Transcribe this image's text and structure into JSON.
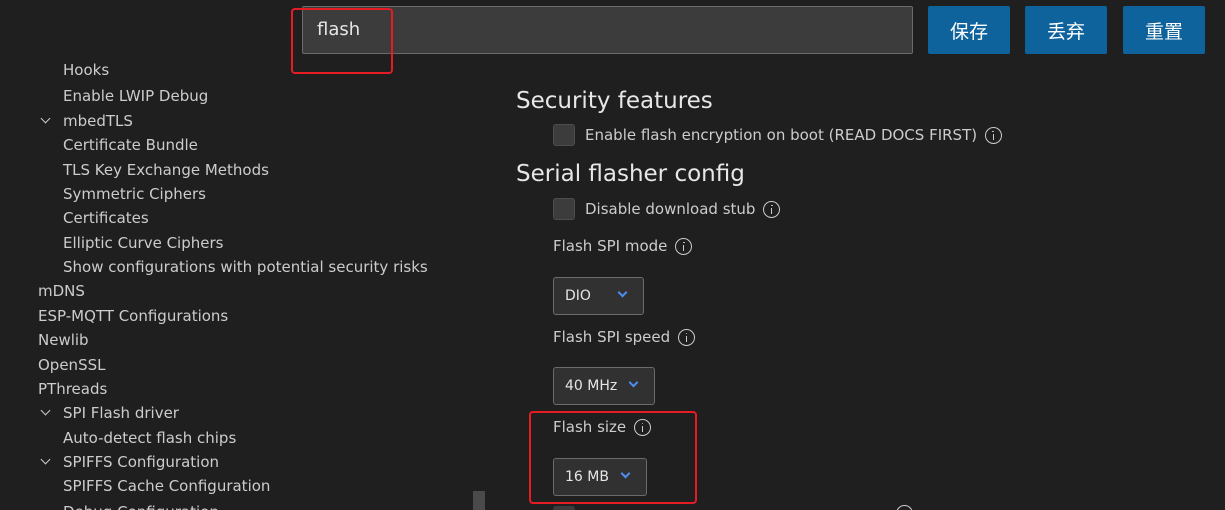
{
  "search": {
    "value": "flash"
  },
  "toolbar": {
    "save_label": "保存",
    "discard_label": "丢弃",
    "reset_label": "重置"
  },
  "sidebar": {
    "items": [
      {
        "label": "Hooks",
        "level": 2,
        "expanded": null
      },
      {
        "label": "Enable LWIP Debug",
        "level": 2,
        "expanded": null
      },
      {
        "label": "mbedTLS",
        "level": 1,
        "expanded": true
      },
      {
        "label": "Certificate Bundle",
        "level": 2,
        "expanded": null
      },
      {
        "label": "TLS Key Exchange Methods",
        "level": 2,
        "expanded": null
      },
      {
        "label": "Symmetric Ciphers",
        "level": 2,
        "expanded": null
      },
      {
        "label": "Certificates",
        "level": 2,
        "expanded": null
      },
      {
        "label": "Elliptic Curve Ciphers",
        "level": 2,
        "expanded": null
      },
      {
        "label": "Show configurations with potential security risks",
        "level": 2,
        "expanded": null
      },
      {
        "label": "mDNS",
        "level": 0,
        "expanded": null
      },
      {
        "label": "ESP-MQTT Configurations",
        "level": 0,
        "expanded": null
      },
      {
        "label": "Newlib",
        "level": 0,
        "expanded": null
      },
      {
        "label": "OpenSSL",
        "level": 0,
        "expanded": null
      },
      {
        "label": "PThreads",
        "level": 0,
        "expanded": null
      },
      {
        "label": "SPI Flash driver",
        "level": 1,
        "expanded": true
      },
      {
        "label": "Auto-detect flash chips",
        "level": 2,
        "expanded": null
      },
      {
        "label": "SPIFFS Configuration",
        "level": 1,
        "expanded": true
      },
      {
        "label": "SPIFFS Cache Configuration",
        "level": 2,
        "expanded": null
      },
      {
        "label": "Debug Configuration",
        "level": 2,
        "expanded": null
      }
    ]
  },
  "main": {
    "security_title": "Security features",
    "flash_encryption_label": "Enable flash encryption on boot (READ DOCS FIRST)",
    "flash_encryption_checked": false,
    "serial_title": "Serial flasher config",
    "disable_stub_label": "Disable download stub",
    "disable_stub_checked": false,
    "spi_mode_label": "Flash SPI mode",
    "spi_mode_value": "DIO",
    "spi_speed_label": "Flash SPI speed",
    "spi_speed_value": "40 MHz",
    "flash_size_label": "Flash size",
    "flash_size_value": "16 MB"
  },
  "colors": {
    "background": "#1f1f1f",
    "button": "#0e639c",
    "highlight": "#e51c23",
    "caret": "#4e8ef0"
  }
}
